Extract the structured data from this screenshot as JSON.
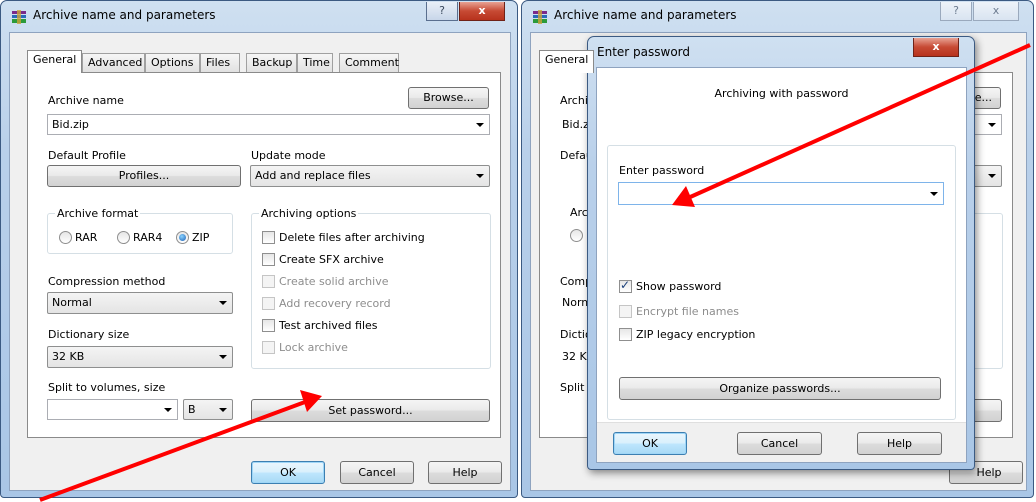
{
  "left_window": {
    "title": "Archive name and parameters",
    "tabs": [
      "General",
      "Advanced",
      "Options",
      "Files",
      "Backup",
      "Time",
      "Comment"
    ],
    "archive_name_label": "Archive name",
    "archive_name_value": "Bid.zip",
    "browse_button": "Browse...",
    "default_profile_label": "Default Profile",
    "profiles_button": "Profiles...",
    "update_mode_label": "Update mode",
    "update_mode_value": "Add and replace files",
    "archive_format_label": "Archive format",
    "formats": [
      "RAR",
      "RAR4",
      "ZIP"
    ],
    "selected_format": "ZIP",
    "archiving_options_label": "Archiving options",
    "options": [
      {
        "label": "Delete files after archiving",
        "checked": false,
        "enabled": true
      },
      {
        "label": "Create SFX archive",
        "checked": false,
        "enabled": true
      },
      {
        "label": "Create solid archive",
        "checked": false,
        "enabled": false
      },
      {
        "label": "Add recovery record",
        "checked": false,
        "enabled": false
      },
      {
        "label": "Test archived files",
        "checked": false,
        "enabled": true
      },
      {
        "label": "Lock archive",
        "checked": false,
        "enabled": false
      }
    ],
    "compression_method_label": "Compression method",
    "compression_method_value": "Normal",
    "dictionary_size_label": "Dictionary size",
    "dictionary_size_value": "32 KB",
    "split_label": "Split to volumes, size",
    "split_value": "",
    "split_unit": "B",
    "set_password_button": "Set password...",
    "ok_button": "OK",
    "cancel_button": "Cancel",
    "help_button": "Help",
    "help_caption": "?",
    "close_caption": "x"
  },
  "right_window": {
    "title": "Archive name and parameters",
    "tab_partial": "General",
    "partial_labels": [
      "Archiv",
      "Bid.z",
      "Defau",
      "Arch",
      "Comp",
      "Norm",
      "Diction",
      "32 KE",
      "Split t"
    ],
    "browse_partial": "e...",
    "help_partial": "Help",
    "help_caption": "?",
    "close_caption": "x"
  },
  "password_dialog": {
    "title": "Enter password",
    "heading": "Archiving with password",
    "enter_password_label": "Enter password",
    "password_value": "",
    "show_password": {
      "label": "Show password",
      "checked": true,
      "enabled": true
    },
    "encrypt_file_names": {
      "label": "Encrypt file names",
      "checked": false,
      "enabled": false
    },
    "zip_legacy": {
      "label": "ZIP legacy encryption",
      "checked": false,
      "enabled": true
    },
    "organize_button": "Organize passwords...",
    "ok_button": "OK",
    "cancel_button": "Cancel",
    "help_button": "Help",
    "close_caption": "x"
  },
  "colors": {
    "annotation_arrow": "#ff0000",
    "titlebar": "#b9d0ea",
    "default_button": "#bee6fd"
  }
}
